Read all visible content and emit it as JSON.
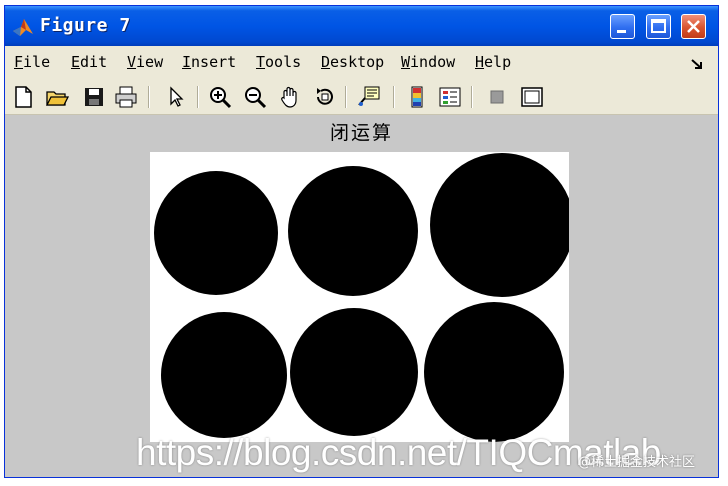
{
  "window": {
    "title": "Figure 7",
    "titlebar_color": "#0055e5",
    "close_color": "#c13b18"
  },
  "menubar": {
    "items": [
      {
        "mnemonic": "F",
        "rest": "ile"
      },
      {
        "mnemonic": "E",
        "rest": "dit"
      },
      {
        "mnemonic": "V",
        "rest": "iew"
      },
      {
        "mnemonic": "I",
        "rest": "nsert"
      },
      {
        "mnemonic": "T",
        "rest": "ools"
      },
      {
        "mnemonic": "D",
        "rest": "esktop"
      },
      {
        "mnemonic": "W",
        "rest": "indow"
      },
      {
        "mnemonic": "H",
        "rest": "elp"
      }
    ]
  },
  "toolbar": {
    "icons": [
      "new-figure-icon",
      "open-file-icon",
      "save-icon",
      "print-icon",
      "arrow-pointer-icon",
      "zoom-in-icon",
      "zoom-out-icon",
      "pan-hand-icon",
      "rotate-3d-icon",
      "data-cursor-icon",
      "colorbar-icon",
      "legend-icon",
      "hide-plot-tools-icon",
      "show-plot-tools-icon"
    ]
  },
  "plot": {
    "title": "闭运算",
    "background": "#c8c8c8",
    "image_description_circles": 6
  },
  "watermark": {
    "main": "https://blog.csdn.net/TIQCmatlab",
    "secondary": "@稀土掘金技术社区"
  }
}
